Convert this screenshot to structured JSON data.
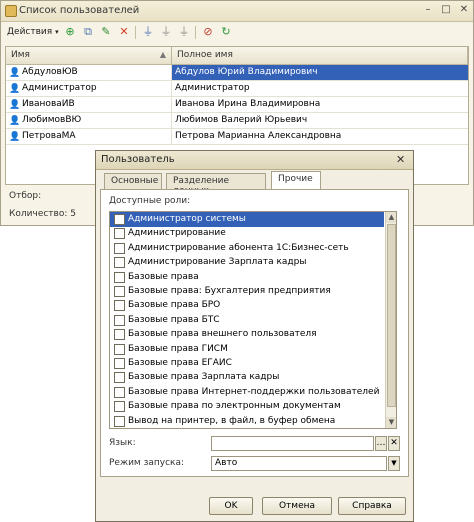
{
  "window": {
    "title": "Список пользователей"
  },
  "toolbar": {
    "actions_label": "Действия"
  },
  "grid": {
    "col_name": "Имя",
    "col_fullname": "Полное имя",
    "rows": [
      {
        "name": "АбдуловЮВ",
        "full": "Абдулов Юрий Владимирович",
        "selected": true
      },
      {
        "name": "Администратор",
        "full": "Администратор"
      },
      {
        "name": "ИвановаИВ",
        "full": "Иванова Ирина Владимировна"
      },
      {
        "name": "ЛюбимовВЮ",
        "full": "Любимов Валерий Юрьевич"
      },
      {
        "name": "ПетроваМА",
        "full": "Петрова Марианна Александровна"
      }
    ]
  },
  "footer": {
    "filter_label": "Отбор:",
    "count_label": "Количество: 5"
  },
  "dialog": {
    "title": "Пользователь",
    "tabs": [
      "Основные",
      "Разделение данных",
      "Прочие"
    ],
    "roles_label": "Доступные роли:",
    "roles": [
      "Администратор системы",
      "Администрирование",
      "Администрирование абонента 1С:Бизнес-сеть",
      "Администрирование Зарплата кадры",
      "Базовые права",
      "Базовые права: Бухгалтерия предприятия",
      "Базовые права БРО",
      "Базовые права БТС",
      "Базовые права внешнего пользователя",
      "Базовые права ГИСМ",
      "Базовые права ЕГАИС",
      "Базовые права Зарплата кадры",
      "Базовые права Интернет-поддержки пользователей",
      "Базовые права по электронным документам",
      "Вывод на принтер, в файл, в буфер обмена"
    ],
    "language_label": "Язык:",
    "language_value": "",
    "mode_label": "Режим запуска:",
    "mode_value": "Авто",
    "ok": "OK",
    "cancel": "Отмена",
    "help": "Справка"
  },
  "colors": {
    "selection": "#3461b8",
    "frame": "#f7f3e6"
  }
}
